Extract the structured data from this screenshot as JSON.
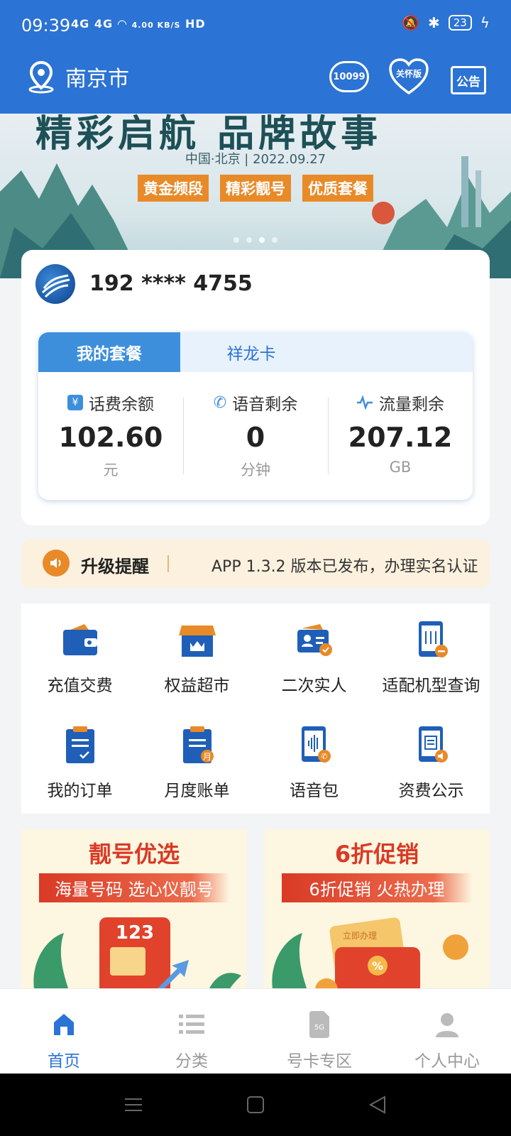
{
  "status_bar": {
    "time": "09:39",
    "signal": "4G 4G",
    "speed": "4.00 KB/S",
    "hd": "HD",
    "battery": "23"
  },
  "header": {
    "city": "南京市",
    "service_badge": "10099",
    "care_badge": "关怀版",
    "notice_badge": "公告"
  },
  "banner": {
    "headline": "精彩启航 品牌故事",
    "subline": "中国·北京 | 2022.09.27",
    "tags": [
      "黄金频段",
      "精彩靓号",
      "优质套餐"
    ],
    "page_count": 4,
    "active_page": 3
  },
  "account": {
    "phone": "192 **** 4755",
    "tabs": [
      {
        "label": "我的套餐",
        "active": true
      },
      {
        "label": "祥龙卡",
        "active": false
      }
    ],
    "stats": [
      {
        "label": "话费余额",
        "value": "102.60",
        "unit": "元",
        "icon": "wallet-icon"
      },
      {
        "label": "语音剩余",
        "value": "0",
        "unit": "分钟",
        "icon": "phone-icon"
      },
      {
        "label": "流量剩余",
        "value": "207.12",
        "unit": "GB",
        "icon": "pulse-icon"
      }
    ]
  },
  "notice": {
    "title": "升级提醒",
    "message": "APP 1.3.2 版本已发布，办理实名认证"
  },
  "menu": [
    {
      "label": "充值交费",
      "icon": "wallet-icon"
    },
    {
      "label": "权益超市",
      "icon": "store-icon"
    },
    {
      "label": "二次实人",
      "icon": "id-card-icon"
    },
    {
      "label": "适配机型查询",
      "icon": "device-query-icon"
    },
    {
      "label": "我的订单",
      "icon": "order-icon"
    },
    {
      "label": "月度账单",
      "icon": "bill-icon"
    },
    {
      "label": "语音包",
      "icon": "voice-pack-icon"
    },
    {
      "label": "资费公示",
      "icon": "tariff-icon"
    }
  ],
  "promos": [
    {
      "title": "靓号优选",
      "subtitle": "海量号码 选心仪靓号",
      "card_text": "123"
    },
    {
      "title": "6折促销",
      "subtitle": "6折促销 火热办理",
      "card_text": "立即办理"
    }
  ],
  "bottom_nav": [
    {
      "label": "首页",
      "active": true
    },
    {
      "label": "分类",
      "active": false
    },
    {
      "label": "号卡专区",
      "active": false
    },
    {
      "label": "个人中心",
      "active": false
    }
  ],
  "colors": {
    "brand_blue": "#2b73d4",
    "accent_orange": "#e88a28",
    "promo_red": "#d93a26"
  }
}
